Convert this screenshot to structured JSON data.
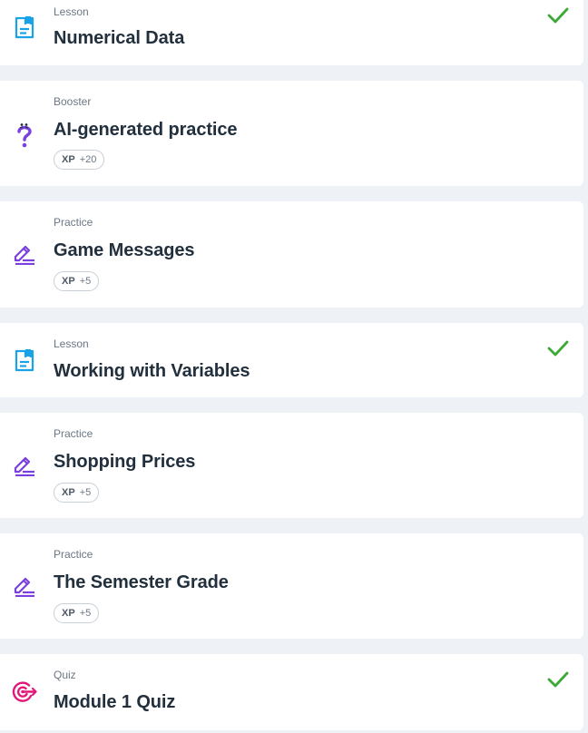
{
  "colors": {
    "lesson_icon": "#1aa2e6",
    "practice_icon": "#7a3fe0",
    "booster_icon": "#7a3fe0",
    "quiz_icon": "#e2197a",
    "check": "#3aaa35",
    "page_bg": "#eef1f5"
  },
  "items": [
    {
      "type": "Lesson",
      "title": "Numerical Data",
      "icon": "lesson-document-icon",
      "completed": true
    },
    {
      "type": "Booster",
      "title": "AI-generated practice",
      "icon": "question-mark-icon",
      "xp_label": "XP",
      "xp_value": "+20"
    },
    {
      "type": "Practice",
      "title": "Game Messages",
      "icon": "pencil-edit-icon",
      "xp_label": "XP",
      "xp_value": "+5"
    },
    {
      "type": "Lesson",
      "title": "Working with Variables",
      "icon": "lesson-document-icon",
      "completed": true
    },
    {
      "type": "Practice",
      "title": "Shopping Prices",
      "icon": "pencil-edit-icon",
      "xp_label": "XP",
      "xp_value": "+5"
    },
    {
      "type": "Practice",
      "title": "The Semester Grade",
      "icon": "pencil-edit-icon",
      "xp_label": "XP",
      "xp_value": "+5"
    },
    {
      "type": "Quiz",
      "title": "Module 1 Quiz",
      "icon": "target-icon",
      "completed": true
    }
  ]
}
